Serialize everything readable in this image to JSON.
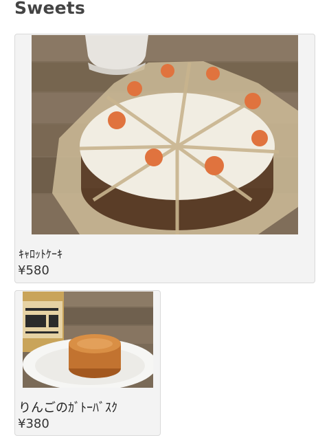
{
  "section": {
    "title": "Sweets"
  },
  "items": [
    {
      "name": "ｷｬﾛｯﾄｹｰｷ",
      "price": "¥580",
      "image": "carrot-cake-photo"
    },
    {
      "name": "りんごのｶﾞﾄｰﾊﾞｽｸ",
      "price": "¥380",
      "image": "apple-gateau-basque-photo"
    }
  ],
  "colors": {
    "card_background": "#f3f3f3",
    "card_border": "#d9d9d9",
    "title_text": "#444444"
  }
}
